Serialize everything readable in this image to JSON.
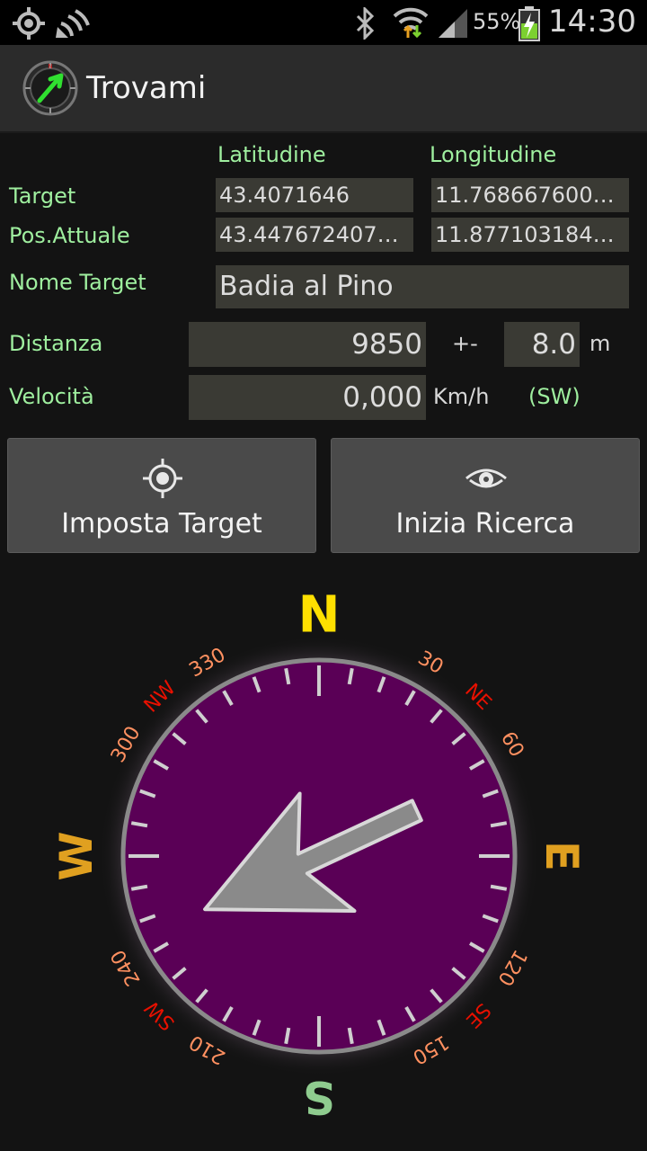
{
  "status_bar": {
    "icons": [
      "gps-icon",
      "satellite-icon",
      "bluetooth-icon",
      "wifi-icon",
      "signal-icon",
      "battery-icon"
    ],
    "battery_percent": "55%",
    "time": "14:30"
  },
  "action_bar": {
    "icon": "compass-app-icon",
    "title": "Trovami"
  },
  "columns": {
    "latitude_header": "Latitudine",
    "longitude_header": "Longitudine"
  },
  "target": {
    "label": "Target",
    "latitude": "43.4071646",
    "longitude": "11.7686676000…"
  },
  "current_position": {
    "label": "Pos.Attuale",
    "latitude": "43.4476724075…",
    "longitude": "11.8771031843…"
  },
  "target_name": {
    "label": "Nome Target",
    "value": "Badia al Pino"
  },
  "distance": {
    "label": "Distanza",
    "value": "9850",
    "plus_minus": "+-",
    "accuracy": "8.0",
    "unit": "m"
  },
  "speed": {
    "label": "Velocità",
    "value": "0,000",
    "unit": "Km/h",
    "direction": "(SW)"
  },
  "buttons": {
    "set_target": {
      "label": "Imposta Target",
      "icon": "crosshair-icon"
    },
    "start_search": {
      "label": "Inizia Ricerca",
      "icon": "eye-icon"
    }
  },
  "compass": {
    "cardinals": {
      "north": "N",
      "east": "E",
      "south": "S",
      "west": "W"
    },
    "intercardinals": {
      "northeast": "NE",
      "southeast": "SE",
      "southwest": "SW",
      "northwest": "NW"
    },
    "degree_labels": [
      "30",
      "60",
      "120",
      "150",
      "210",
      "240",
      "300",
      "330"
    ],
    "arrow_heading_deg": 245,
    "colors": {
      "dial_fill": "#5a0056",
      "north": "#ffe000",
      "east_west": "#e0a020",
      "south": "#8fcc8f",
      "intercardinal": "#e81000",
      "degree": "#ff9060",
      "ticks": "#cfcfcf",
      "arrow": "#8a8a8a"
    }
  }
}
